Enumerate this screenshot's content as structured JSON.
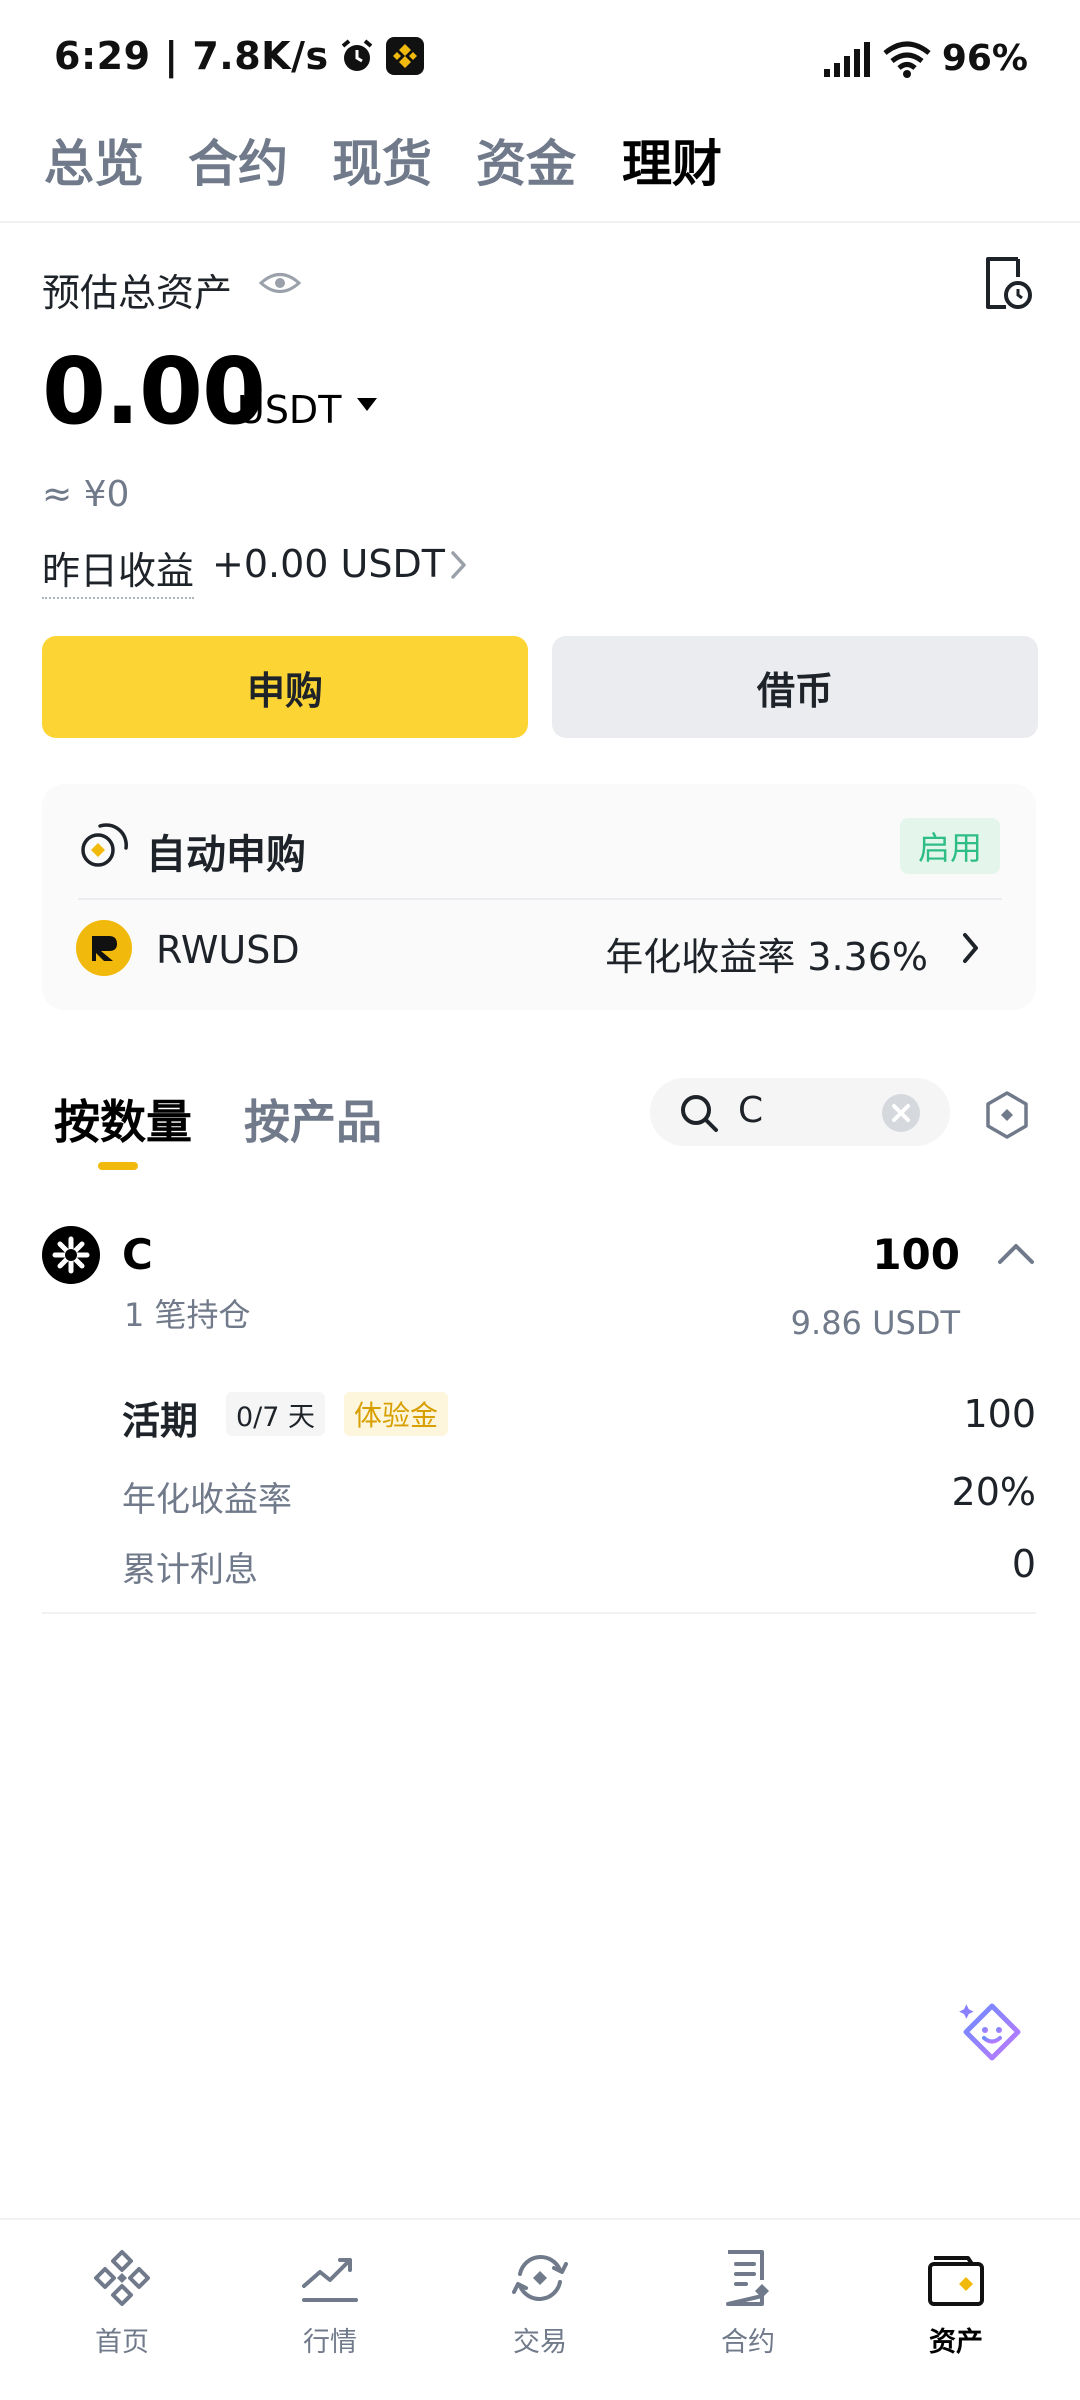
{
  "status_bar": {
    "time": "6:29 | 7.8K/s",
    "battery": "96%"
  },
  "top_tabs": [
    {
      "label": "总览",
      "active": false
    },
    {
      "label": "合约",
      "active": false
    },
    {
      "label": "现货",
      "active": false
    },
    {
      "label": "资金",
      "active": false
    },
    {
      "label": "理财",
      "active": true
    }
  ],
  "overview": {
    "assets_label": "预估总资产",
    "total_amount": "0.00",
    "total_unit": "USDT",
    "cny_value": "≈ ¥0",
    "yesterday_label": "昨日收益",
    "yesterday_value": "+0.00 USDT"
  },
  "actions": {
    "subscribe_label": "申购",
    "borrow_label": "借币"
  },
  "auto_subscribe": {
    "title": "自动申购",
    "badge": "启用",
    "asset_name": "RWUSD",
    "apy_text": "年化收益率 3.36%"
  },
  "sub_tabs": {
    "by_amount": "按数量",
    "by_product": "按产品"
  },
  "search": {
    "value": "C"
  },
  "holding": {
    "coin": "C",
    "positions": "1 笔持仓",
    "quantity": "100",
    "usdt_value": "9.86 USDT",
    "flex_label": "活期",
    "days_badge": "0/7 天",
    "trial_badge": "体验金",
    "flex_value": "100",
    "apy_label": "年化收益率",
    "apy_value": "20%",
    "interest_label": "累计利息",
    "interest_value": "0"
  },
  "bottom_nav": [
    {
      "label": "首页",
      "icon": "binance-logo-icon",
      "active": false
    },
    {
      "label": "行情",
      "icon": "chart-icon",
      "active": false
    },
    {
      "label": "交易",
      "icon": "trade-icon",
      "active": false
    },
    {
      "label": "合约",
      "icon": "contract-icon",
      "active": false
    },
    {
      "label": "资产",
      "icon": "wallet-icon",
      "active": true
    }
  ],
  "colors": {
    "brand_yellow": "#fcd535",
    "accent_gold": "#f0b90b",
    "success_green": "#2ebd85",
    "text_primary": "#1e2329",
    "text_secondary": "#707a8a"
  }
}
